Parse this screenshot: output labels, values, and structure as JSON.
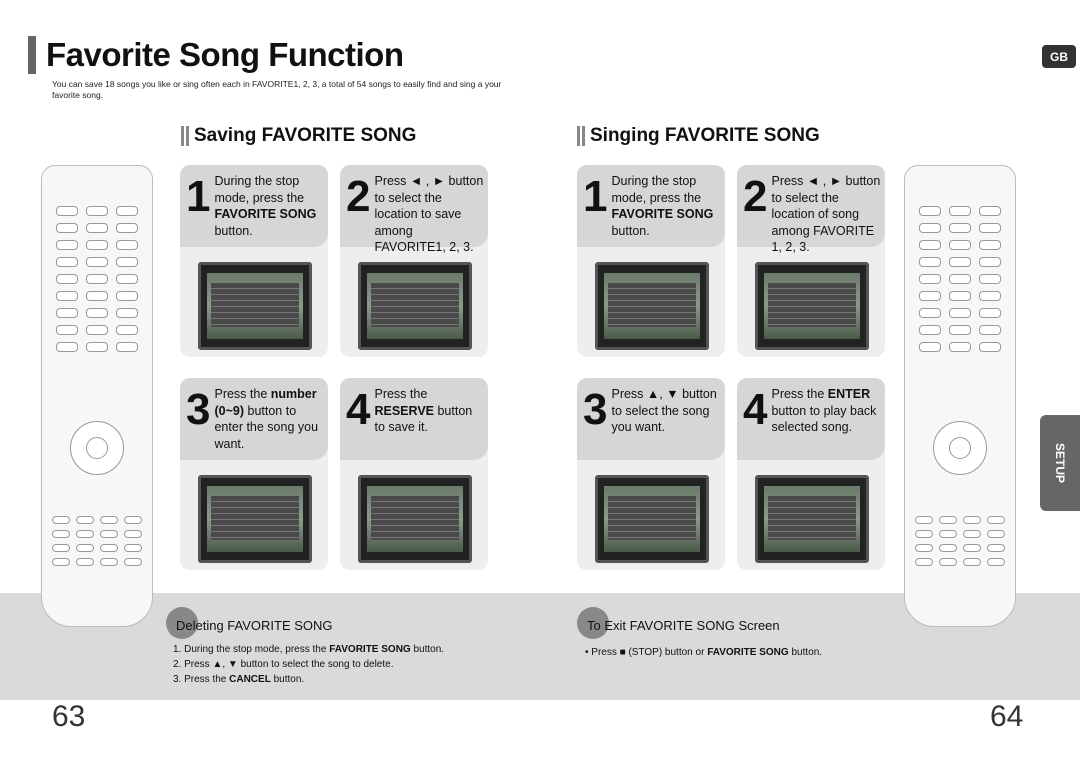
{
  "title": "Favorite Song Function",
  "intro": "You can save 18 songs you like or sing often each in FAVORITE1, 2, 3, a total of 54 songs to easily find and sing a your favorite song.",
  "badge": "GB",
  "side_tab": "SETUP",
  "saving": {
    "heading": "Saving FAVORITE SONG",
    "steps": [
      {
        "num": "1",
        "pre": "During the stop mode, press the ",
        "bold": "FAVORITE SONG",
        "post": " button."
      },
      {
        "num": "2",
        "pre": "Press ◄ , ► button to select the location to save among FAVORITE1, 2, 3.",
        "bold": "",
        "post": ""
      },
      {
        "num": "3",
        "pre": "Press the ",
        "bold": "number (0~9)",
        "post": " button to enter the song you want."
      },
      {
        "num": "4",
        "pre": "Press the ",
        "bold": "RESERVE",
        "post": " button to save it."
      }
    ]
  },
  "singing": {
    "heading": "Singing FAVORITE SONG",
    "steps": [
      {
        "num": "1",
        "pre": "During the stop mode, press the ",
        "bold": "FAVORITE SONG",
        "post": " button."
      },
      {
        "num": "2",
        "pre": "Press ◄ , ► button to select the location of song among FAVORITE 1, 2, 3.",
        "bold": "",
        "post": ""
      },
      {
        "num": "3",
        "pre": "Press ▲, ▼ button to select the song you want.",
        "bold": "",
        "post": ""
      },
      {
        "num": "4",
        "pre": "Press the ",
        "bold": "ENTER",
        "post": " button to play back selected song."
      }
    ]
  },
  "deleting": {
    "heading": "Deleting FAVORITE SONG",
    "items": [
      {
        "pre": "1. During the stop mode, press the ",
        "bold": "FAVORITE SONG",
        "post": " button."
      },
      {
        "pre": "2. Press ▲, ▼ button to select the song to delete.",
        "bold": "",
        "post": ""
      },
      {
        "pre": "3. Press the ",
        "bold": "CANCEL",
        "post": " button."
      }
    ]
  },
  "exit": {
    "heading": "To Exit FAVORITE SONG Screen",
    "pre": "• Press ■ (STOP) button or ",
    "bold": "FAVORITE SONG",
    "post": " button."
  },
  "page_left": "63",
  "page_right": "64"
}
